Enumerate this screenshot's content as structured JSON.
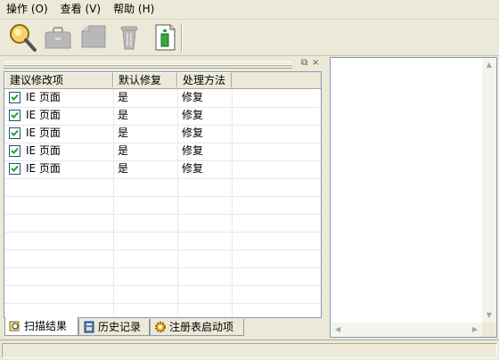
{
  "menu": [
    {
      "label": "操作",
      "accel": "(O)"
    },
    {
      "label": "查看",
      "accel": "(V)"
    },
    {
      "label": "帮助",
      "accel": "(H)"
    }
  ],
  "toolbar": {
    "icons": [
      "magnifier-icon",
      "toolbox-icon",
      "folder-icon",
      "trash-icon",
      "document-icon"
    ]
  },
  "table": {
    "headers": [
      "建议修改项",
      "默认修复",
      "处理方法"
    ],
    "rows": [
      {
        "checked": true,
        "item": "IE 页面",
        "default": "是",
        "method": "修复"
      },
      {
        "checked": true,
        "item": "IE 页面",
        "default": "是",
        "method": "修复"
      },
      {
        "checked": true,
        "item": "IE 页面",
        "default": "是",
        "method": "修复"
      },
      {
        "checked": true,
        "item": "IE 页面",
        "default": "是",
        "method": "修复"
      },
      {
        "checked": true,
        "item": "IE 页面",
        "default": "是",
        "method": "修复"
      }
    ]
  },
  "tabs": [
    {
      "label": "扫描结果",
      "active": true
    },
    {
      "label": "历史记录",
      "active": false
    },
    {
      "label": "注册表启动项",
      "active": false
    }
  ],
  "panel_controls": {
    "restore": "⧉",
    "close": "×"
  },
  "colors": {
    "face": "#ece9d8",
    "border": "#7f9db9",
    "check": "#1c5180"
  }
}
